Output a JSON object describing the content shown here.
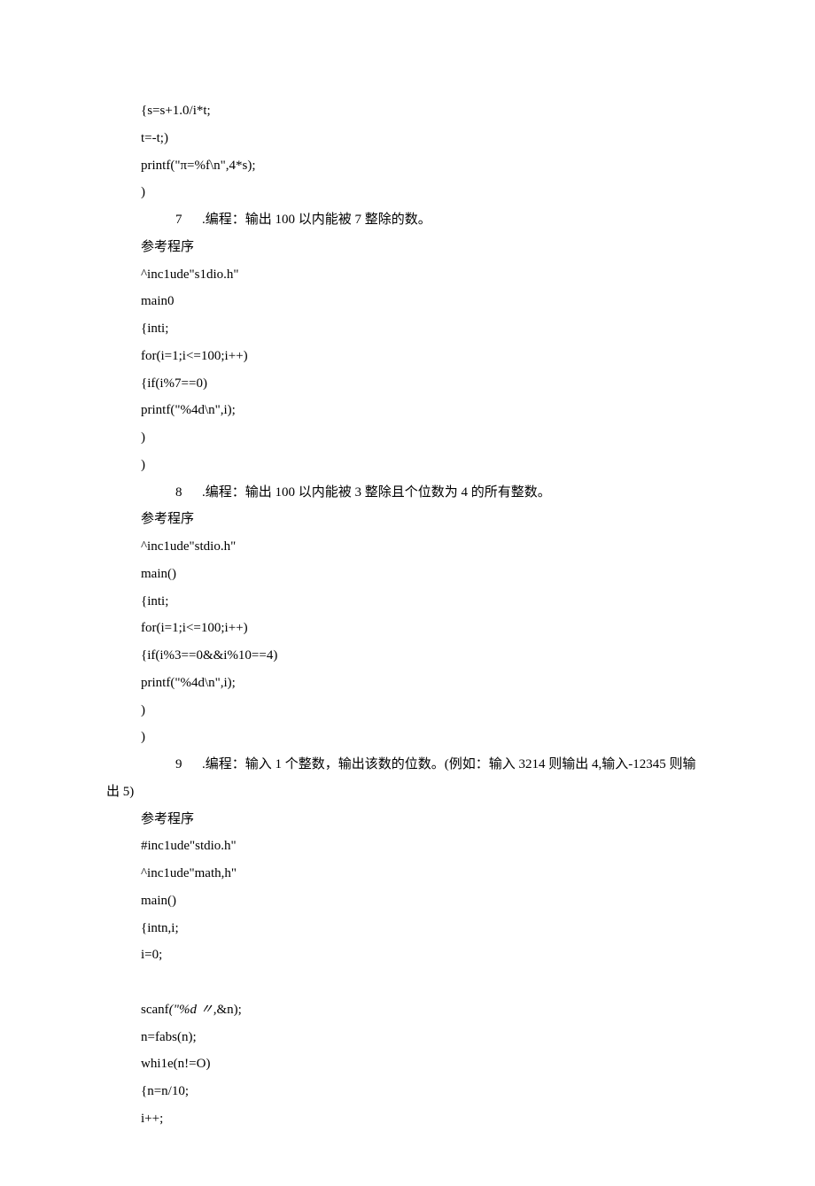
{
  "lines": [
    "{s=s+1.0/i*t;",
    "t=-t;)",
    "printf(\"π=%f\\n\",4*s);",
    ")"
  ],
  "q7": {
    "num": "7",
    "title": ".编程：输出 100 以内能被 7 整除的数。",
    "ref": "参考程序",
    "code": [
      "^inc1ude\"s1dio.h\"",
      "main0",
      "{inti;",
      "for(i=1;i<=100;i++)",
      "{if(i%7==0)",
      "printf(\"%4d\\n\",i);",
      ")",
      ")"
    ]
  },
  "q8": {
    "num": "8",
    "title": ".编程：输出 100 以内能被 3 整除且个位数为 4 的所有整数。",
    "ref": "参考程序",
    "code": [
      "^inc1ude\"stdio.h\"",
      "main()",
      "{inti;",
      "for(i=1;i<=100;i++)",
      "{if(i%3==0&&i%10==4)",
      "printf(\"%4d\\n\",i);",
      ")",
      ")"
    ]
  },
  "q9": {
    "num": "9",
    "title": ".编程：输入 1 个整数，输出该数的位数。(例如：输入 3214 则输出 4,输入-12345 则输",
    "cont": "出 5)",
    "ref": "参考程序",
    "code1": [
      "#inc1ude\"stdio.h\"",
      "^inc1ude\"math,h\"",
      "main()",
      "{intn,i;",
      "i=0;"
    ],
    "scanf_pre": "scanf",
    "scanf_ital": "(\"%d 〃,",
    "scanf_post": "&n);",
    "code2": [
      "n=fabs(n);",
      "whi1e(n!=O)",
      "{n=n/10;",
      "i++;"
    ]
  }
}
